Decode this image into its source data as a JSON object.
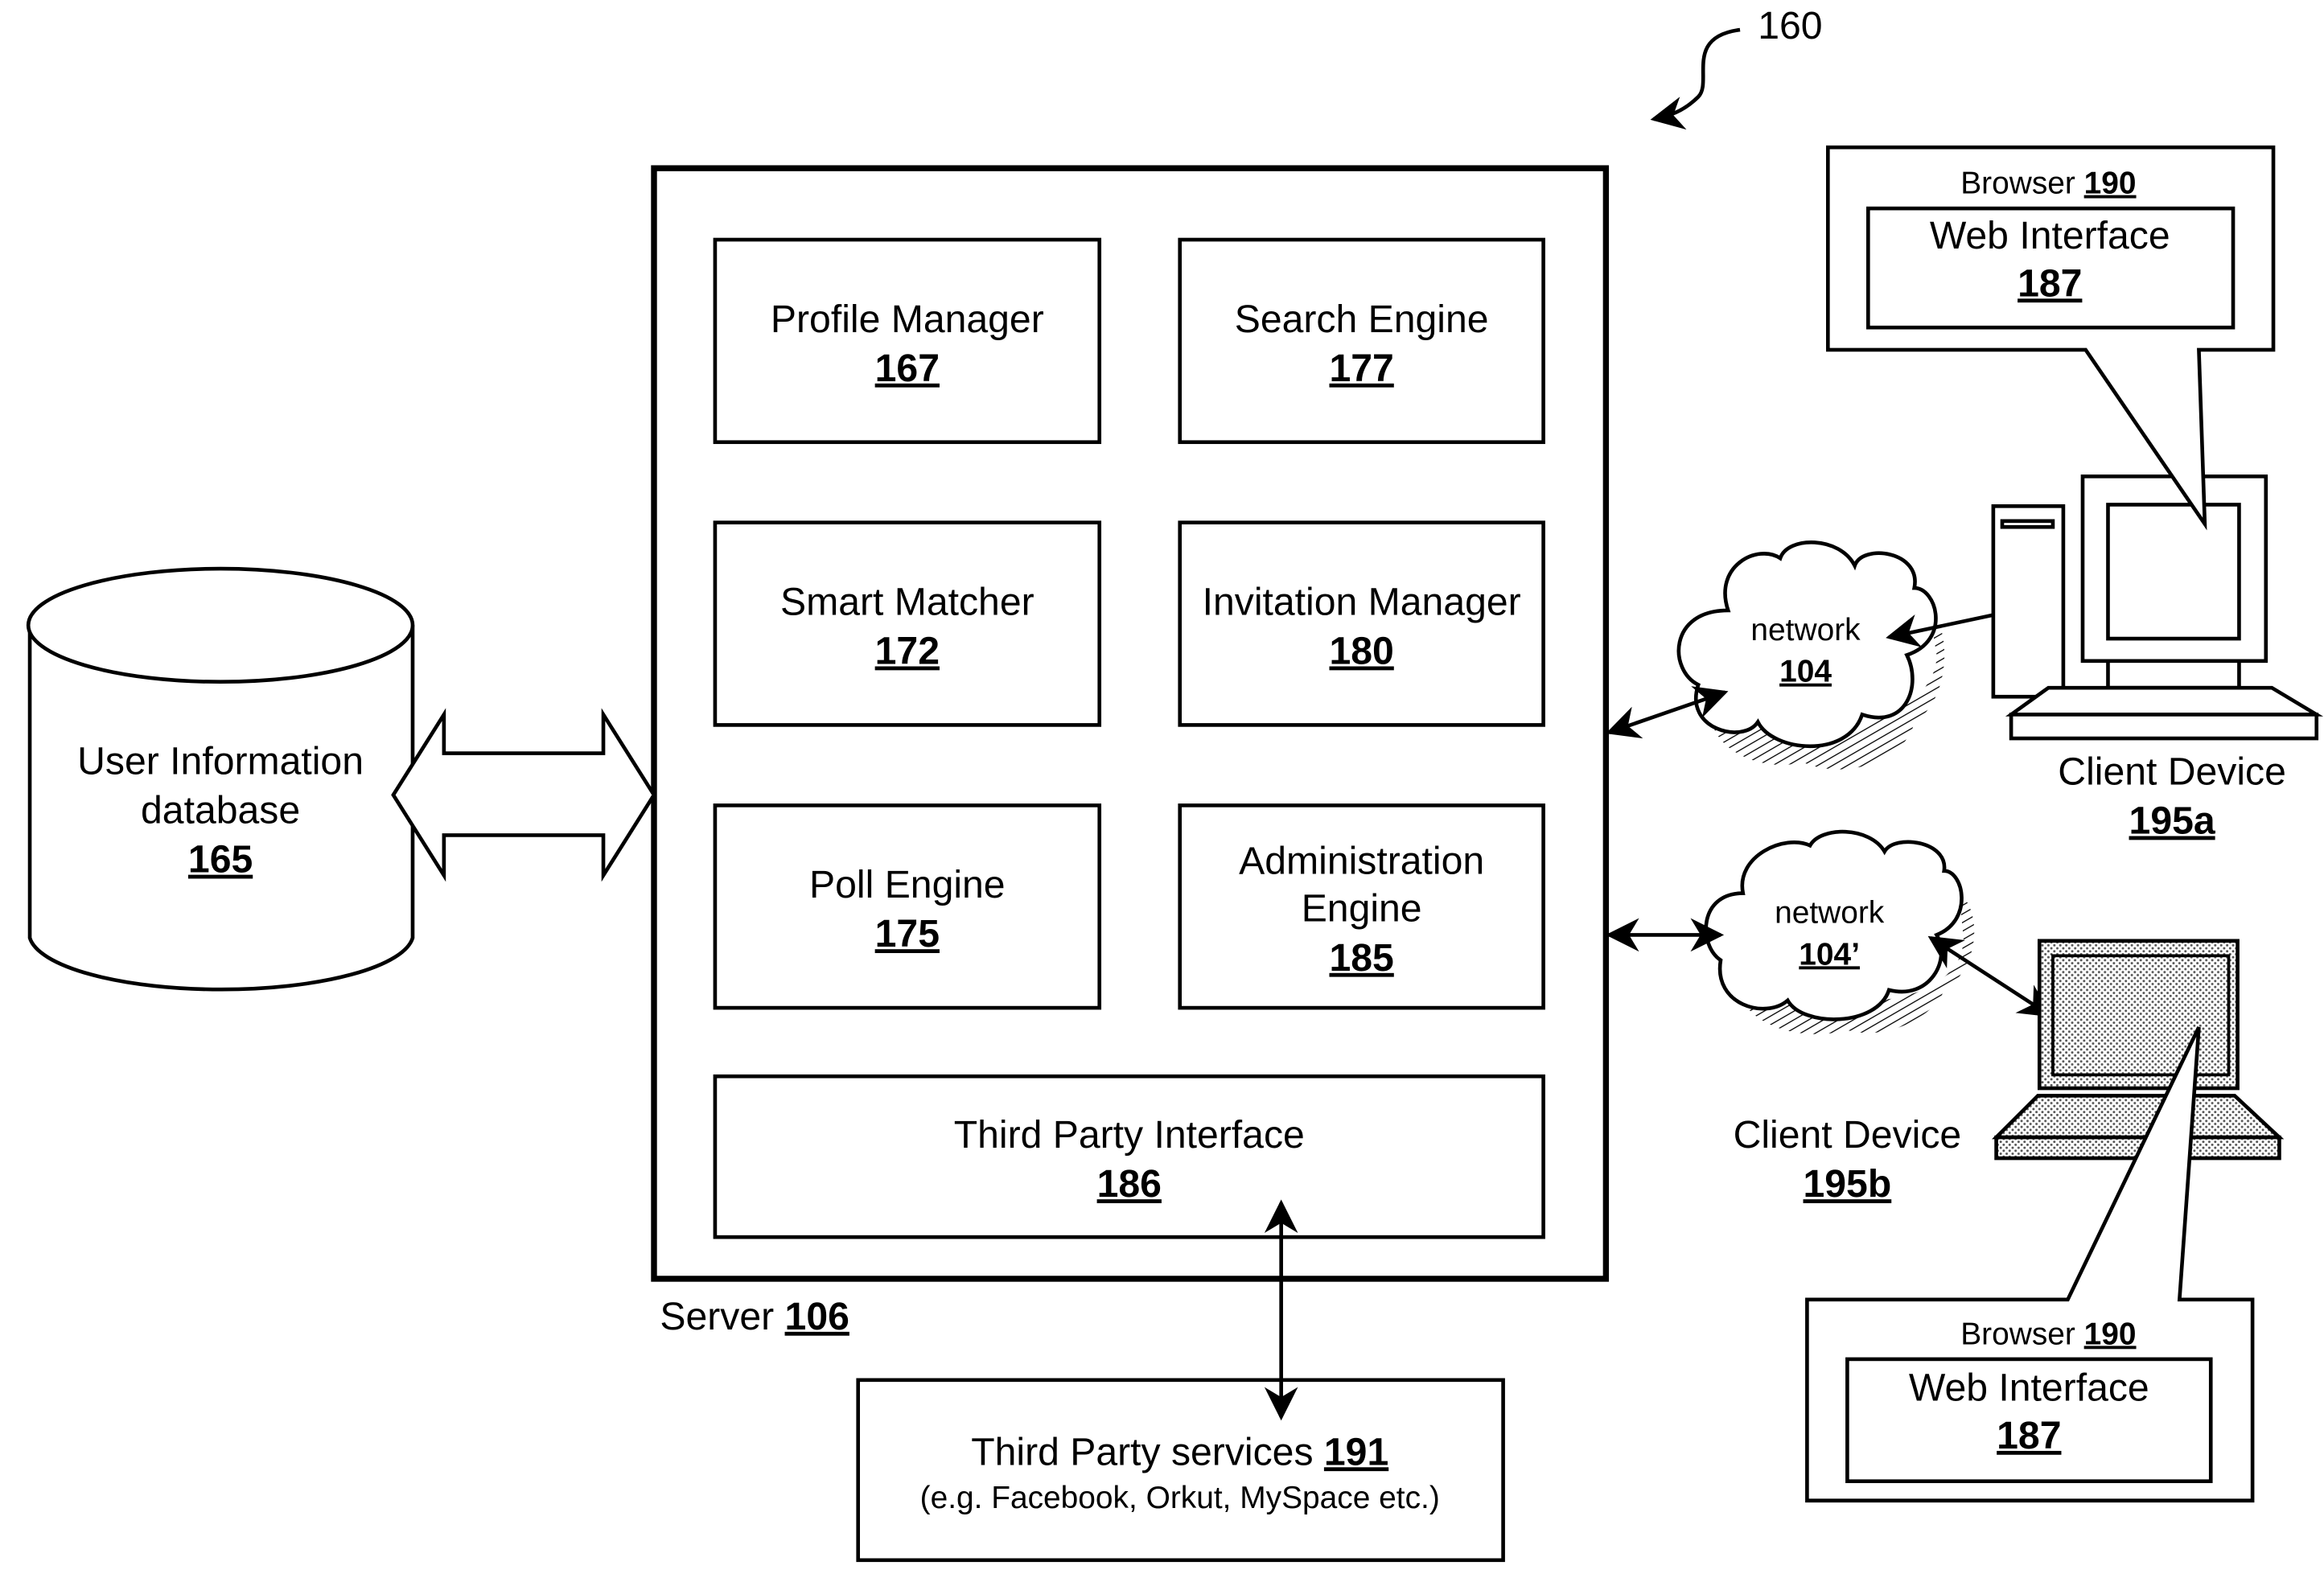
{
  "figure_ref": "160",
  "server": {
    "label": "Server",
    "num": "106"
  },
  "modules": [
    {
      "label": "Profile Manager",
      "num": "167"
    },
    {
      "label": "Search Engine",
      "num": "177"
    },
    {
      "label": "Smart Matcher",
      "num": "172"
    },
    {
      "label": "Invitation Manager",
      "num": "180"
    },
    {
      "label": "Poll Engine",
      "num": "175"
    },
    {
      "label_line1": "Administration",
      "label_line2": "Engine",
      "num": "185"
    },
    {
      "label": "Third Party Interface",
      "num": "186"
    }
  ],
  "database": {
    "line1": "User Information",
    "line2": "database",
    "num": "165"
  },
  "third_party": {
    "label": "Third Party services",
    "num": "191",
    "examples": "(e.g. Facebook, Orkut, MySpace etc.)"
  },
  "networks": [
    {
      "label": "network",
      "num": "104"
    },
    {
      "label": "network",
      "num": "104’"
    }
  ],
  "clients": [
    {
      "label": "Client Device",
      "num": "195a"
    },
    {
      "label": "Client Device",
      "num": "195b"
    }
  ],
  "browsers": [
    {
      "label": "Browser",
      "num": "190",
      "inner_label": "Web Interface",
      "inner_num": "187"
    },
    {
      "label": "Browser",
      "num": "190",
      "inner_label": "Web Interface",
      "inner_num": "187"
    }
  ]
}
